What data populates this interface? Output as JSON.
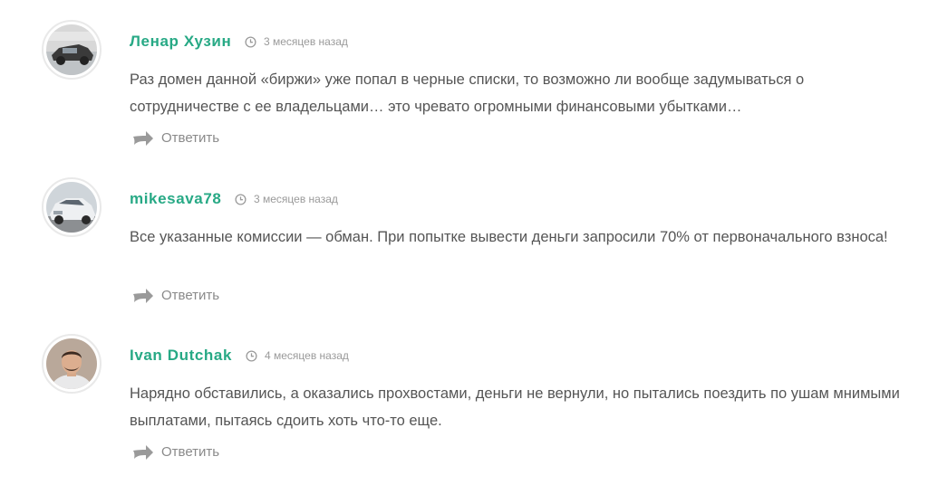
{
  "comments": [
    {
      "author": "Ленар Хузин",
      "time": "3 месяцев назад",
      "text": "Раз домен данной «биржи» уже попал в черные списки, то возможно ли вообще задумываться о сотрудничестве с ее владельцами… это чревато огромными финансовыми убытками…",
      "reply_label": "Ответить"
    },
    {
      "author": "mikesava78",
      "time": "3 месяцев назад",
      "text": "Все указанные комиссии — обман. При попытке вывести деньги запросили 70% от первоначального взноса!",
      "reply_label": "Ответить"
    },
    {
      "author": "Ivan Dutchak",
      "time": "4 месяцев назад",
      "text": "Нарядно обставились, а оказались прохвостами, деньги не вернули, но пытались поездить по ушам мнимыми выплатами, пытаясь сдоить хоть что-то еще.",
      "reply_label": "Ответить"
    }
  ],
  "colors": {
    "author": "#27a985",
    "text": "#555555",
    "meta": "#9a9a9a",
    "reply": "#8a8a8a"
  },
  "icons": {
    "time": "clock-icon",
    "reply": "reply-arrow-icon"
  }
}
